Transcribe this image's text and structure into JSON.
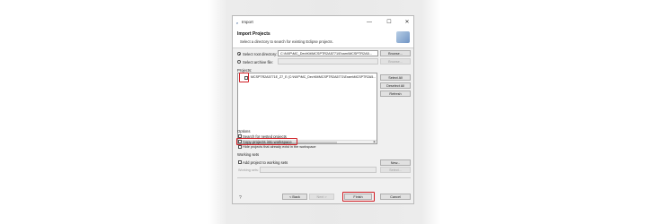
{
  "window": {
    "title": "Import",
    "app_icon": "e",
    "min_glyph": "—",
    "max_glyph": "☐",
    "close_glyph": "✕"
  },
  "header": {
    "title": "Import Projects",
    "description": "Select a directory to search for existing Eclipse projects."
  },
  "source": {
    "root_label": "Select root directory:",
    "root_value": "C:\\NXP\\MC_Dev\\Kit\\MCSPTR2A5771\\Exam\\MCSPTR2A5...",
    "archive_label": "Select archive file:",
    "archive_value": "",
    "browse_label": "Browse...",
    "browse_label_2": "Browse..."
  },
  "projects": {
    "label": "Projects:",
    "items": [
      {
        "name": "MCSPTR2A5771E_Z7_E (C:\\NXP\\MC_Dev\\Kit\\MCSPTR2A5771\\Exam\\MCSPTR2A5...",
        "checked": false
      }
    ],
    "select_all": "Select All",
    "deselect_all": "Deselect All",
    "refresh": "Refresh"
  },
  "options": {
    "label": "Options",
    "search_nested": "Search for nested projects",
    "copy_into_workspace": "Copy projects into workspace",
    "hide_existing": "Hide projects that already exist in the workspace"
  },
  "working_sets": {
    "label": "Working sets",
    "add_label": "Add project to working sets",
    "sets_label": "Working sets:",
    "sets_value": "",
    "new_label": "New...",
    "select_label": "Select..."
  },
  "footer": {
    "help_glyph": "?",
    "back": "< Back",
    "next": "Next >",
    "finish": "Finish",
    "cancel": "Cancel"
  },
  "colors": {
    "highlight": "#d11f26",
    "dialog_bg": "#f0f0f0"
  }
}
